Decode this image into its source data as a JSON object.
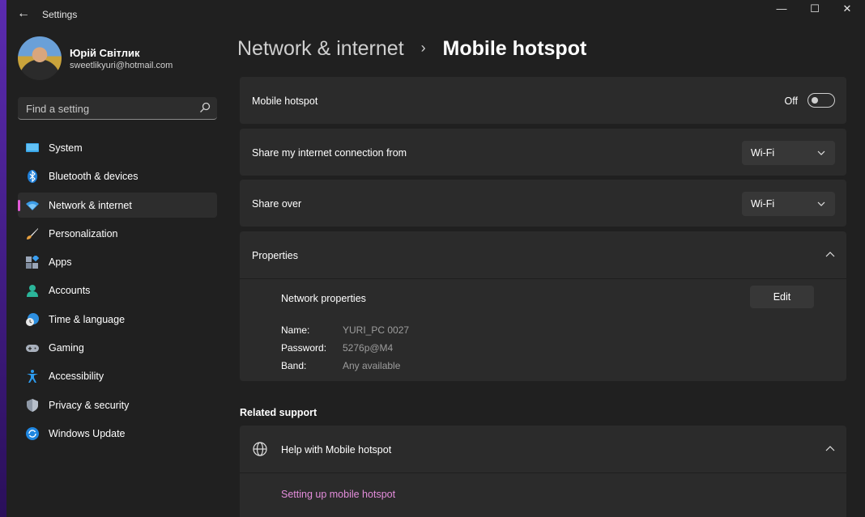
{
  "window": {
    "title": "Settings",
    "back_glyph": "←",
    "controls": {
      "minimize": "—",
      "maximize": "☐",
      "close": "✕"
    }
  },
  "user": {
    "name": "Юрій Світлик",
    "email": "sweetlikyuri@hotmail.com"
  },
  "search": {
    "placeholder": "Find a setting"
  },
  "nav": {
    "items": [
      {
        "label": "System",
        "icon": "monitor-icon",
        "active": false
      },
      {
        "label": "Bluetooth & devices",
        "icon": "bluetooth-icon",
        "active": false
      },
      {
        "label": "Network & internet",
        "icon": "wifi-icon",
        "active": true
      },
      {
        "label": "Personalization",
        "icon": "brush-icon",
        "active": false
      },
      {
        "label": "Apps",
        "icon": "apps-icon",
        "active": false
      },
      {
        "label": "Accounts",
        "icon": "person-icon",
        "active": false
      },
      {
        "label": "Time & language",
        "icon": "clock-globe-icon",
        "active": false
      },
      {
        "label": "Gaming",
        "icon": "gamepad-icon",
        "active": false
      },
      {
        "label": "Accessibility",
        "icon": "accessibility-icon",
        "active": false
      },
      {
        "label": "Privacy & security",
        "icon": "shield-icon",
        "active": false
      },
      {
        "label": "Windows Update",
        "icon": "update-icon",
        "active": false
      }
    ]
  },
  "breadcrumb": {
    "parent": "Network & internet",
    "separator": "›",
    "current": "Mobile hotspot"
  },
  "hotspot": {
    "label": "Mobile hotspot",
    "state_text": "Off",
    "enabled": false
  },
  "share_from": {
    "label": "Share my internet connection from",
    "value": "Wi-Fi"
  },
  "share_over": {
    "label": "Share over",
    "value": "Wi-Fi"
  },
  "properties": {
    "label": "Properties",
    "network_properties_label": "Network properties",
    "edit_label": "Edit",
    "fields": {
      "name_key": "Name:",
      "name_value": "YURI_PC 0027",
      "password_key": "Password:",
      "password_value": "5276p@M4",
      "band_key": "Band:",
      "band_value": "Any available"
    }
  },
  "related_support": {
    "title": "Related support",
    "help_label": "Help with Mobile hotspot",
    "link_label": "Setting up mobile hotspot"
  },
  "colors": {
    "accent": "#e05ad6",
    "link": "#e48ddc",
    "background": "#202020",
    "card": "#2b2b2b"
  }
}
